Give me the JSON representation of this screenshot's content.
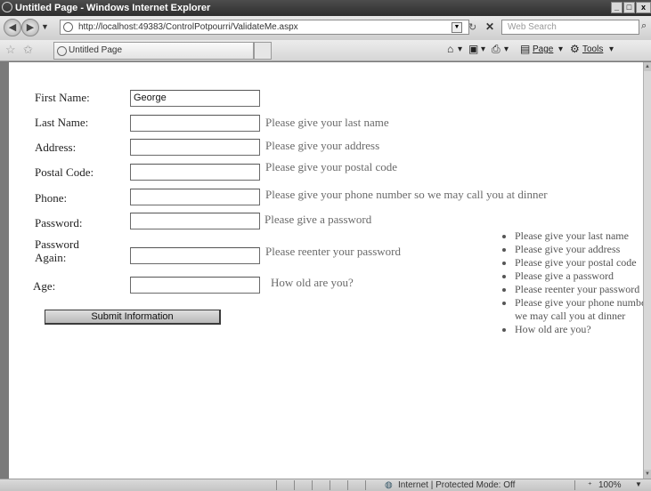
{
  "window": {
    "title": "Untitled Page - Windows Internet Explorer"
  },
  "addressbar": {
    "url": "http://localhost:49383/ControlPotpourri/ValidateMe.aspx",
    "search_placeholder": "Web Search"
  },
  "tab": {
    "label": "Untitled Page"
  },
  "commandbar": {
    "page_label": "Page",
    "tools_label": "Tools"
  },
  "form": {
    "fields": [
      {
        "label": "First Name:",
        "value": "George",
        "error": ""
      },
      {
        "label": "Last Name:",
        "value": "",
        "error": "Please give your last name"
      },
      {
        "label": "Address:",
        "value": "",
        "error": "Please give your address"
      },
      {
        "label": "Postal Code:",
        "value": "",
        "error": "Please give your postal code"
      },
      {
        "label": "Phone:",
        "value": "",
        "error": "Please give your phone number so we may call you at dinner"
      },
      {
        "label": "Password:",
        "value": "",
        "error": "Please give a password"
      },
      {
        "label": "Password Again:",
        "value": "",
        "error": "Please reenter your password"
      },
      {
        "label": "Age:",
        "value": "",
        "error": "How old are you?"
      }
    ],
    "submit_label": "Submit Information"
  },
  "validation_summary": [
    "Please give your last name",
    "Please give your address",
    "Please give your postal code",
    "Please give a password",
    "Please reenter your password",
    "Please give your phone number so we may call you at dinner",
    "How old are you?"
  ],
  "statusbar": {
    "zone_text": "Internet | Protected Mode: Off",
    "zoom": "100%"
  }
}
